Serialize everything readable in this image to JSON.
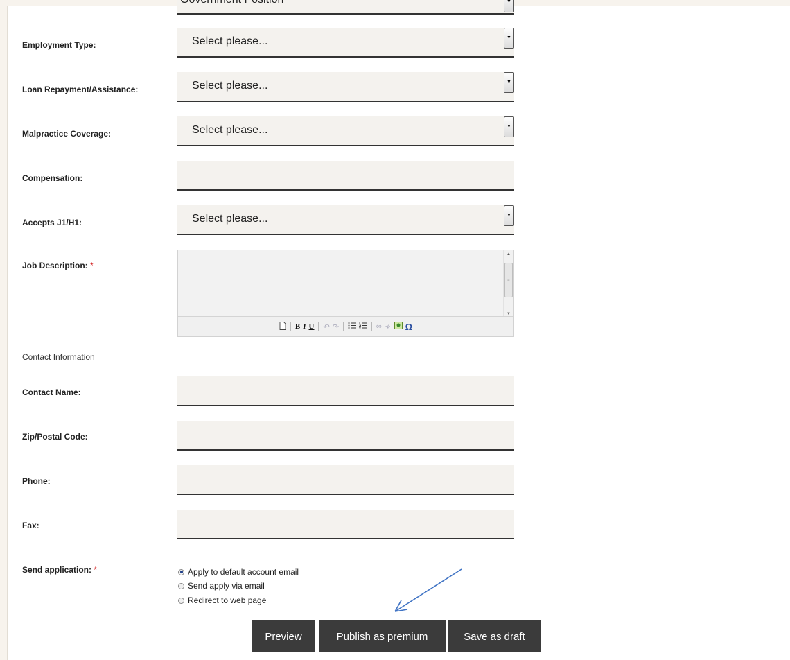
{
  "form": {
    "prev_field_value": "Government Position",
    "fields": [
      {
        "label": "Employment Type:",
        "type": "select",
        "value": "Select please..."
      },
      {
        "label": "Loan Repayment/Assistance:",
        "type": "select",
        "value": "Select please..."
      },
      {
        "label": "Malpractice Coverage:",
        "type": "select",
        "value": "Select please..."
      },
      {
        "label": "Compensation:",
        "type": "text",
        "value": ""
      },
      {
        "label": "Accepts J1/H1:",
        "type": "select",
        "value": "Select please..."
      }
    ],
    "job_description": {
      "label": "Job Description:",
      "required_mark": "*",
      "value": ""
    },
    "contact_section_title": "Contact Information",
    "contact_fields": [
      {
        "label": "Contact Name:",
        "value": ""
      },
      {
        "label": "Zip/Postal Code:",
        "value": ""
      },
      {
        "label": "Phone:",
        "value": ""
      },
      {
        "label": "Fax:",
        "value": ""
      }
    ],
    "send_application": {
      "label": "Send application:",
      "required_mark": "*",
      "options": [
        {
          "label": "Apply to default account email",
          "selected": true
        },
        {
          "label": "Send apply via email",
          "selected": false
        },
        {
          "label": "Redirect to web page",
          "selected": false
        }
      ]
    }
  },
  "editor_toolbar": {
    "icons": [
      "new-page-icon",
      "bold-icon",
      "italic-icon",
      "underline-icon",
      "undo-icon",
      "redo-icon",
      "bulleted-list-icon",
      "numbered-list-icon",
      "link-icon",
      "unlink-icon",
      "image-icon",
      "special-char-icon"
    ],
    "bold_glyph": "B",
    "italic_glyph": "I",
    "underline_glyph": "U",
    "special_char_glyph": "Ω"
  },
  "actions": {
    "preview": "Preview",
    "publish": "Publish as premium",
    "save_draft": "Save as draft"
  },
  "annotation_color": "#3f73c4"
}
